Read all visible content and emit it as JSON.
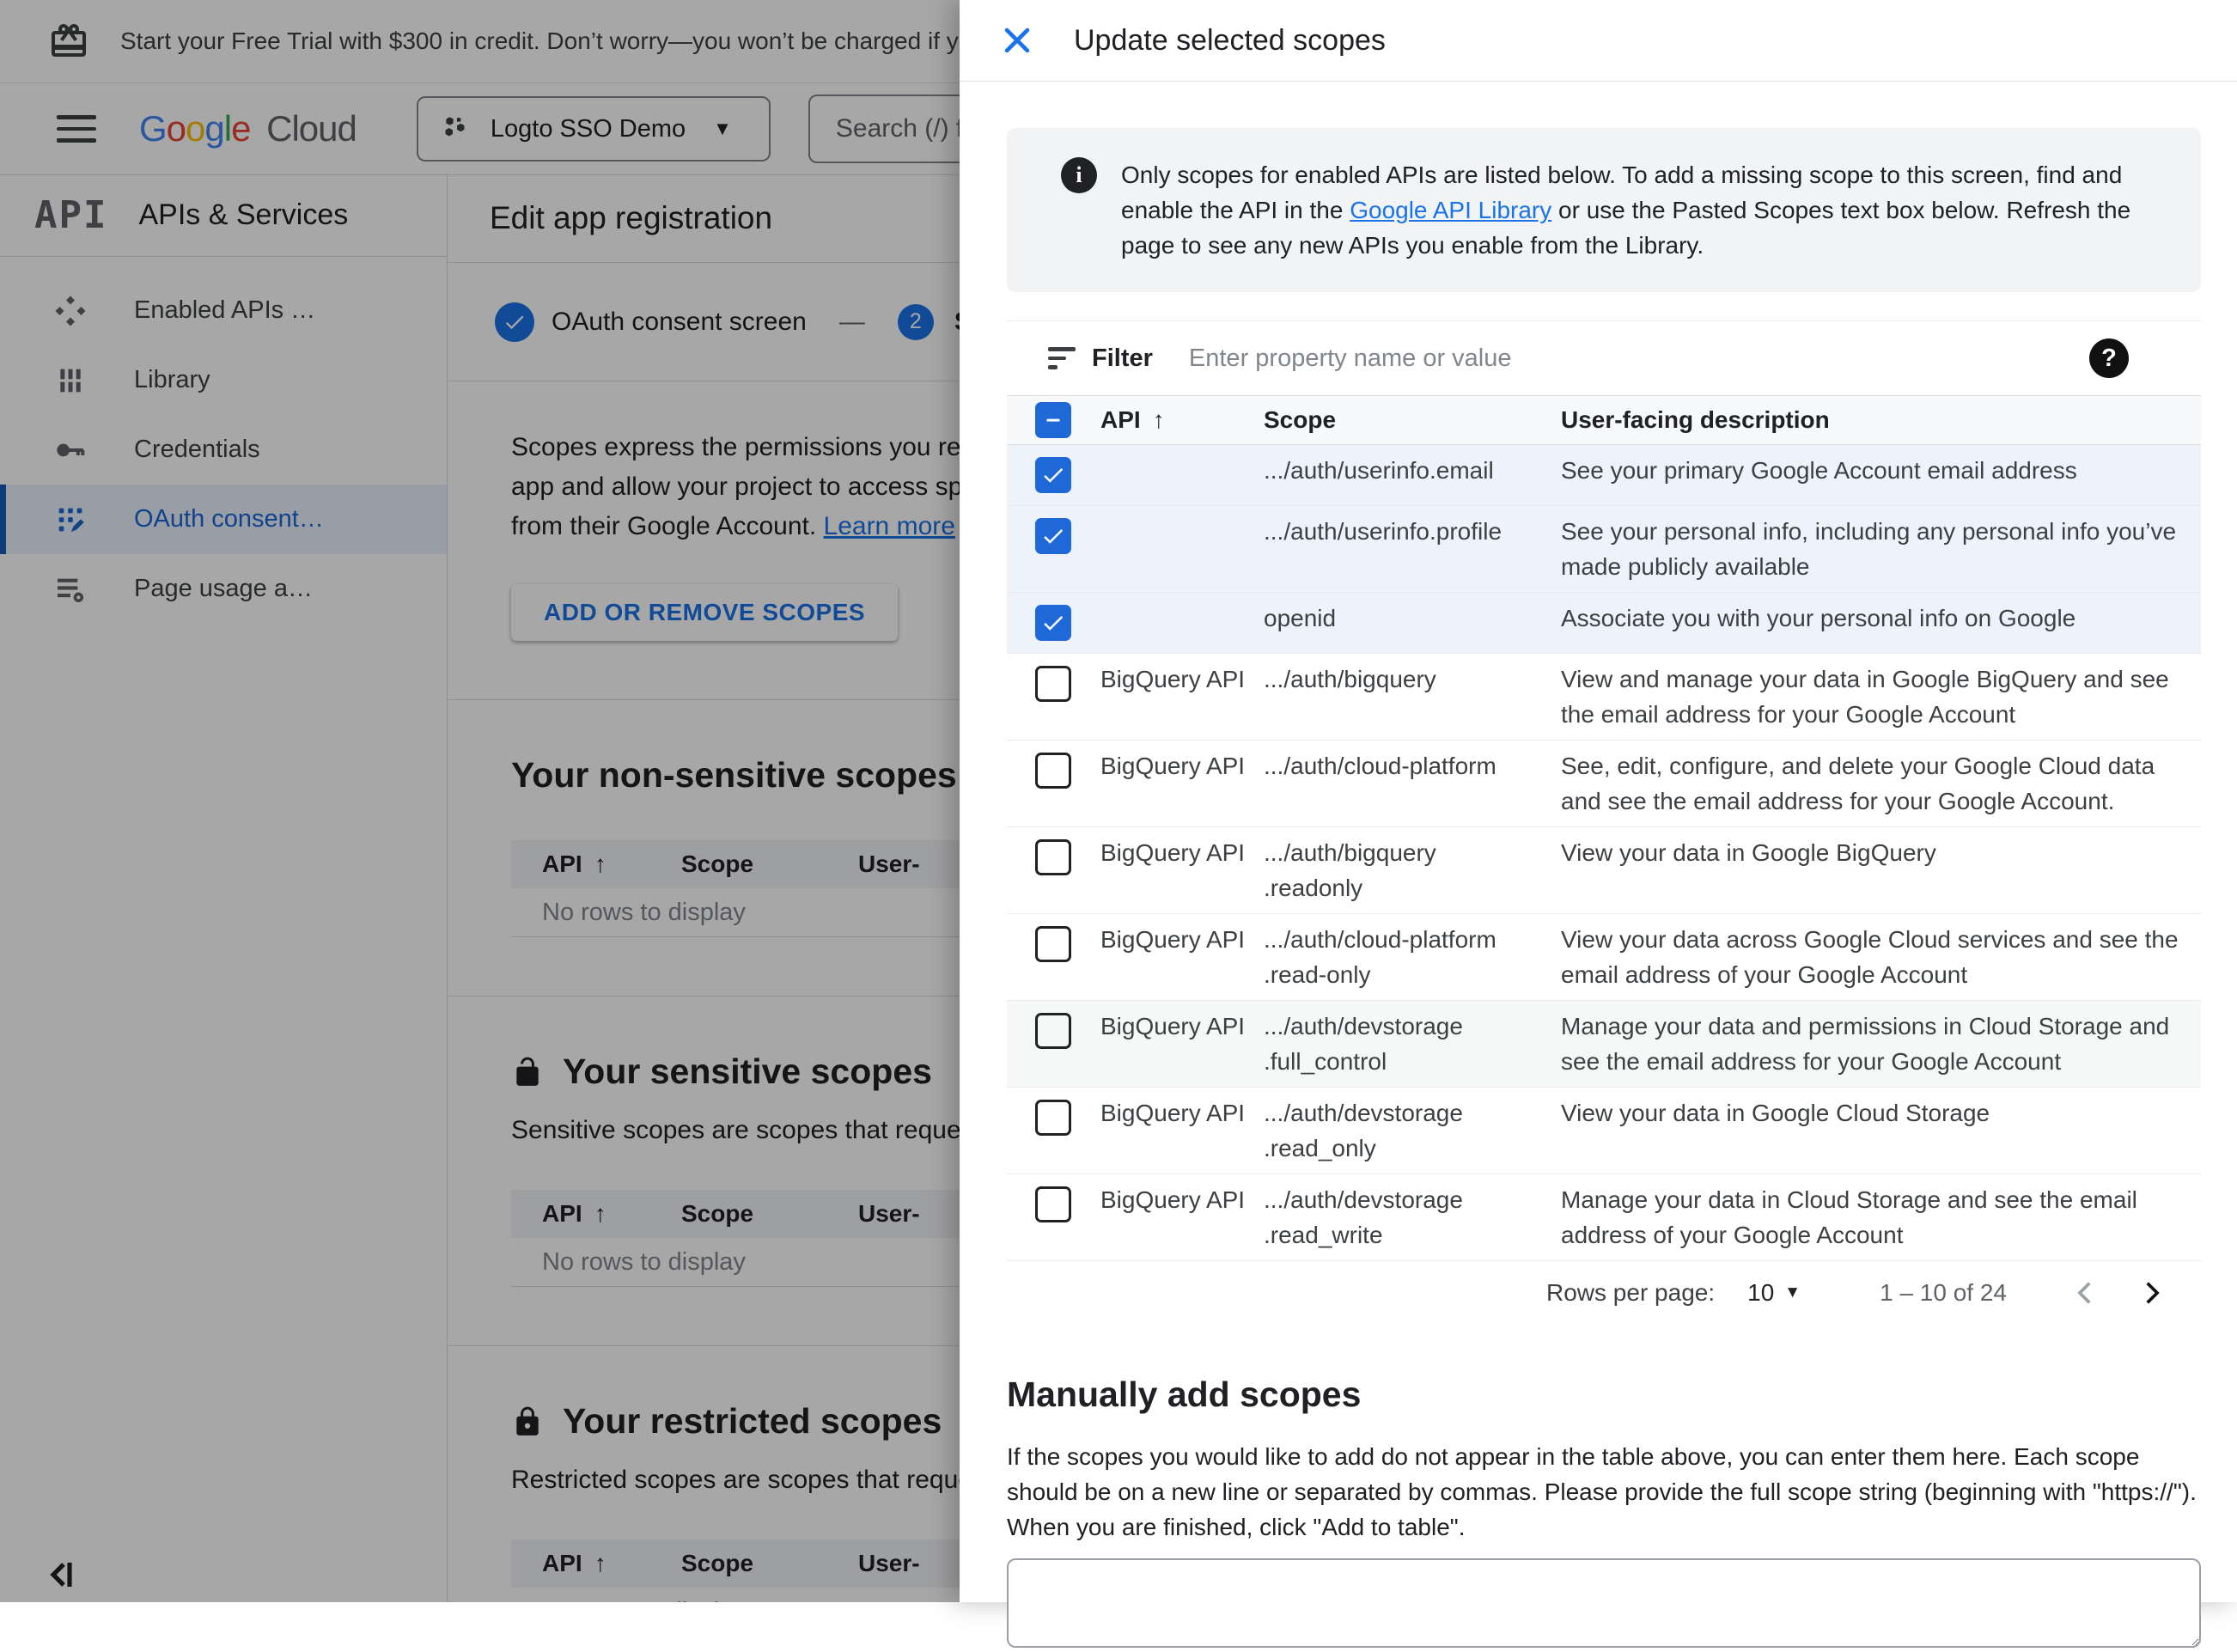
{
  "banner": {
    "text": "Start your Free Trial with $300 in credit. Don’t worry—you won’t be charged if you run out of c"
  },
  "header": {
    "logo_google_letters": [
      "G",
      "o",
      "o",
      "g",
      "l",
      "e"
    ],
    "logo_cloud": "Cloud",
    "project_name": "Logto SSO Demo",
    "search_placeholder": "Search (/) for resou"
  },
  "sidebar": {
    "product_logo": "API",
    "product_title": "APIs & Services",
    "items": [
      {
        "label": "Enabled APIs …"
      },
      {
        "label": "Library"
      },
      {
        "label": "Credentials"
      },
      {
        "label": "OAuth consent…"
      },
      {
        "label": "Page usage a…"
      }
    ]
  },
  "main": {
    "title": "Edit app registration",
    "stepper": {
      "step1_label": "OAuth consent screen",
      "dash": "—",
      "step2_number": "2",
      "step2_label": "Sco"
    },
    "intro_line1": "Scopes express the permissions you re",
    "intro_line2": "app and allow your project to access sp",
    "intro_line3": "from their Google Account. ",
    "learn_more": "Learn more",
    "add_button": "ADD OR REMOVE SCOPES",
    "sort_arrow": "↑",
    "sections": [
      {
        "title": "Your non-sensitive scopes",
        "description": "",
        "col_api": "API",
        "col_scope": "Scope",
        "col_desc": "User-",
        "empty": "No rows to display"
      },
      {
        "title": "Your sensitive scopes",
        "description": "Sensitive scopes are scopes that request acc",
        "col_api": "API",
        "col_scope": "Scope",
        "col_desc": "User-",
        "empty": "No rows to display"
      },
      {
        "title": "Your restricted scopes",
        "description": "Restricted scopes are scopes that request ac",
        "col_api": "API",
        "col_scope": "Scope",
        "col_desc": "User-",
        "empty": "No rows to display"
      }
    ]
  },
  "panel": {
    "title": "Update selected scopes",
    "info": {
      "text_before_link": "Only scopes for enabled APIs are listed below. To add a missing scope to this screen, find and enable the API in the ",
      "link": "Google API Library",
      "text_after_link": " or use the Pasted Scopes text box below. Refresh the page to see any new APIs you enable from the Library."
    },
    "filter": {
      "label": "Filter",
      "placeholder": "Enter property name or value"
    },
    "table": {
      "col_api": "API",
      "col_scope": "Scope",
      "col_desc": "User-facing description",
      "sort_arrow": "↑",
      "rows": [
        {
          "checked": true,
          "selected": true,
          "hover": false,
          "api": "",
          "scope": ".../auth/userinfo.email",
          "description": "See your primary Google Account email address"
        },
        {
          "checked": true,
          "selected": true,
          "hover": false,
          "api": "",
          "scope": ".../auth/userinfo.profile",
          "description": "See your personal info, including any personal info you’ve made publicly available"
        },
        {
          "checked": true,
          "selected": true,
          "hover": false,
          "api": "",
          "scope": "openid",
          "description": "Associate you with your personal info on Google"
        },
        {
          "checked": false,
          "selected": false,
          "hover": false,
          "api": "BigQuery API",
          "scope": ".../auth/bigquery",
          "description": "View and manage your data in Google BigQuery and see the email address for your Google Account"
        },
        {
          "checked": false,
          "selected": false,
          "hover": false,
          "api": "BigQuery API",
          "scope": ".../auth/cloud-platform",
          "description": "See, edit, configure, and delete your Google Cloud data and see the email address for your Google Account."
        },
        {
          "checked": false,
          "selected": false,
          "hover": false,
          "api": "BigQuery API",
          "scope": ".../auth/bigquery\n.readonly",
          "description": "View your data in Google BigQuery"
        },
        {
          "checked": false,
          "selected": false,
          "hover": false,
          "api": "BigQuery API",
          "scope": ".../auth/cloud-platform\n.read-only",
          "description": "View your data across Google Cloud services and see the email address of your Google Account"
        },
        {
          "checked": false,
          "selected": false,
          "hover": true,
          "api": "BigQuery API",
          "scope": ".../auth/devstorage\n.full_control",
          "description": "Manage your data and permissions in Cloud Storage and see the email address for your Google Account"
        },
        {
          "checked": false,
          "selected": false,
          "hover": false,
          "api": "BigQuery API",
          "scope": ".../auth/devstorage\n.read_only",
          "description": "View your data in Google Cloud Storage"
        },
        {
          "checked": false,
          "selected": false,
          "hover": false,
          "api": "BigQuery API",
          "scope": ".../auth/devstorage\n.read_write",
          "description": "Manage your data in Cloud Storage and see the email address of your Google Account"
        }
      ]
    },
    "pagination": {
      "rows_per_page_label": "Rows per page:",
      "rows_per_page_value": "10",
      "range": "1 – 10 of 24"
    },
    "manual": {
      "title": "Manually add scopes",
      "description": "If the scopes you would like to add do not appear in the table above, you can enter them here. Each scope should be on a new line or separated by commas. Please provide the full scope string (beginning with \"https://\"). When you are finished, click \"Add to table\"."
    }
  },
  "colors": {
    "accent_blue": "#1a73e8",
    "checkbox_blue": "#1e68d7",
    "selected_row": "#eef3fb",
    "nav_selected_bg": "#e8f0fe"
  }
}
